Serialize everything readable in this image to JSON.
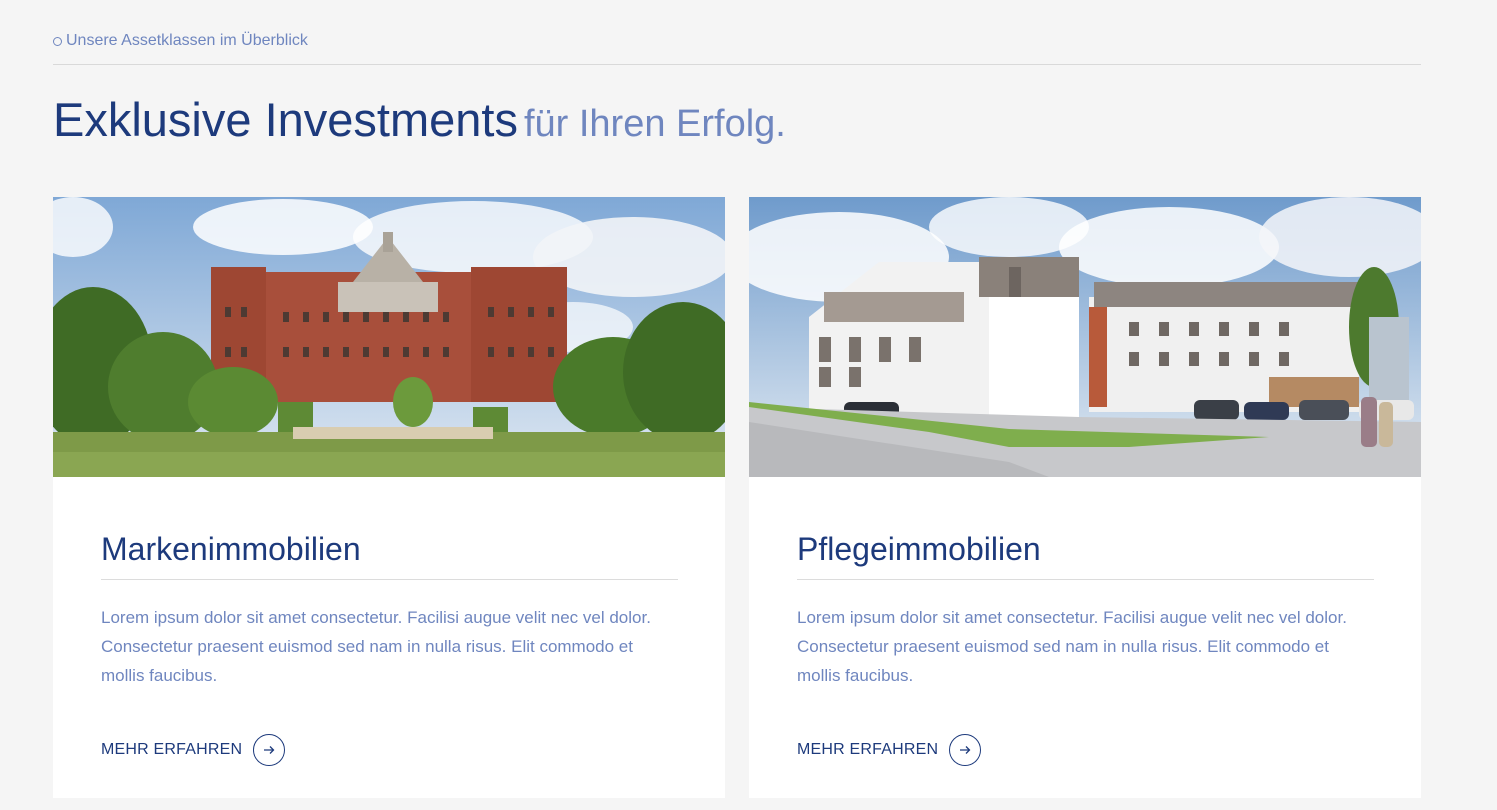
{
  "section": {
    "eyebrow": "Unsere Assetklassen im Überblick",
    "headline_main": "Exklusive Investments",
    "headline_accent": "für Ihren Erfolg."
  },
  "cards": [
    {
      "title": "Markenimmobilien",
      "text": "Lorem ipsum dolor sit amet consectetur. Facilisi augue velit nec vel dolor. Consectetur praesent euismod sed nam in nulla risus. Elit commodo et mollis faucibus.",
      "link_label": "MEHR ERFAHREN",
      "link_icon": "arrow-right-icon",
      "image": "brick-historic-building-photo"
    },
    {
      "title": "Pflegeimmobilien",
      "text": "Lorem ipsum dolor sit amet consectetur. Facilisi augue velit nec vel dolor. Consectetur praesent euismod sed nam in nulla risus. Elit commodo et mollis faucibus.",
      "link_label": "MEHR ERFAHREN",
      "link_icon": "arrow-right-icon",
      "image": "modern-care-home-rendering"
    }
  ],
  "colors": {
    "primary": "#1d3a7c",
    "accent": "#6f86bf",
    "background": "#f5f5f5",
    "card": "#ffffff"
  }
}
